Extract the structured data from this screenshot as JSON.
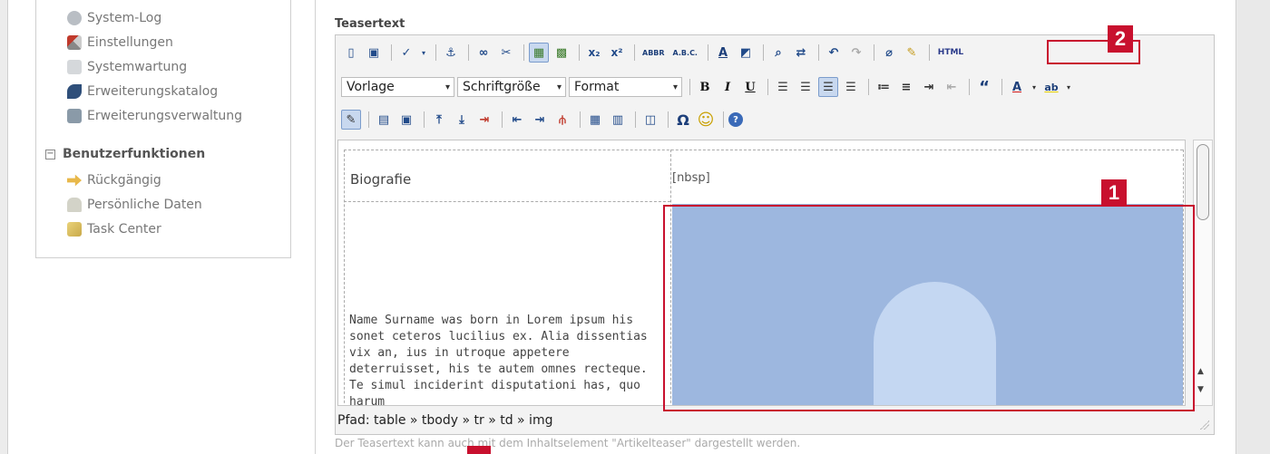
{
  "sidebar": {
    "items": [
      {
        "label": "System-Log",
        "icon": "system-log-icon"
      },
      {
        "label": "Einstellungen",
        "icon": "tools-icon"
      },
      {
        "label": "Systemwartung",
        "icon": "maintenance-icon"
      },
      {
        "label": "Erweiterungskatalog",
        "icon": "catalog-icon"
      },
      {
        "label": "Erweiterungsverwaltung",
        "icon": "extension-manager-icon"
      }
    ],
    "section": {
      "toggle": "−",
      "title": "Benutzerfunktionen"
    },
    "user_items": [
      {
        "label": "Rückgängig",
        "icon": "undo-arrow-icon"
      },
      {
        "label": "Persönliche Daten",
        "icon": "personal-data-icon"
      },
      {
        "label": "Task Center",
        "icon": "task-center-icon"
      }
    ]
  },
  "field": {
    "label": "Teasertext"
  },
  "toolbar": {
    "style_select": "Vorlage",
    "fontsize_select": "Schriftgröße",
    "format_select": "Format",
    "bold": "B",
    "italic": "I",
    "underline": "U",
    "subscript": "x₂",
    "superscript": "x²",
    "abbr": "ABBR",
    "acronym": "A.B.C.",
    "html": "HTML",
    "quote": "“",
    "font_color": "A",
    "highlight": "ab",
    "omega": "Ω",
    "smiley": "☺"
  },
  "editor": {
    "heading": "Biografie",
    "nbsp": "[nbsp]",
    "paragraph": "Name Surname was born in Lorem ipsum his sonet ceteros lucilius ex. Alia dissentias vix an, ius in utroque appetere deterruisset, his te autem omnes recteque. Te simul inciderint disputationi has, quo harum",
    "path": "Pfad: table » tbody » tr » td » img"
  },
  "hint": "Der Teasertext kann auch mit dem Inhaltselement \"Artikelteaser\" dargestellt werden.",
  "callouts": {
    "one": "1",
    "two": "2"
  },
  "colors": {
    "callout": "#c8102e",
    "image_bg": "#9db7df"
  }
}
